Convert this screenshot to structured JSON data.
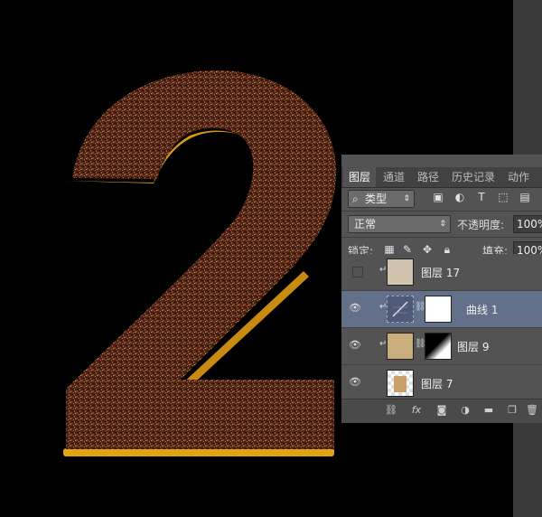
{
  "panel": {
    "tabs": [
      "图层",
      "通道",
      "路径",
      "历史记录",
      "动作"
    ],
    "kind_filter": "类型",
    "filter_icons": [
      "image-filter-icon",
      "adjustment-filter-icon",
      "type-filter-icon",
      "shape-filter-icon",
      "smart-object-filter-icon"
    ],
    "blend_mode": "正常",
    "opacity_label": "不透明度:",
    "opacity_value": "100%",
    "lock_label": "锁定:",
    "fill_label": "填充:",
    "fill_value": "100%",
    "layers": [
      {
        "name": "图层 17",
        "visible": false,
        "selected": false
      },
      {
        "name": "曲线 1",
        "visible": true,
        "selected": true
      },
      {
        "name": "图层 9",
        "visible": true,
        "selected": false
      },
      {
        "name": "图层 7",
        "visible": true,
        "selected": false
      }
    ]
  },
  "canvas": {
    "digit": "2",
    "colors": {
      "texture": "#5a2a18",
      "bevel": "#d89a14",
      "background": "#000000"
    }
  }
}
